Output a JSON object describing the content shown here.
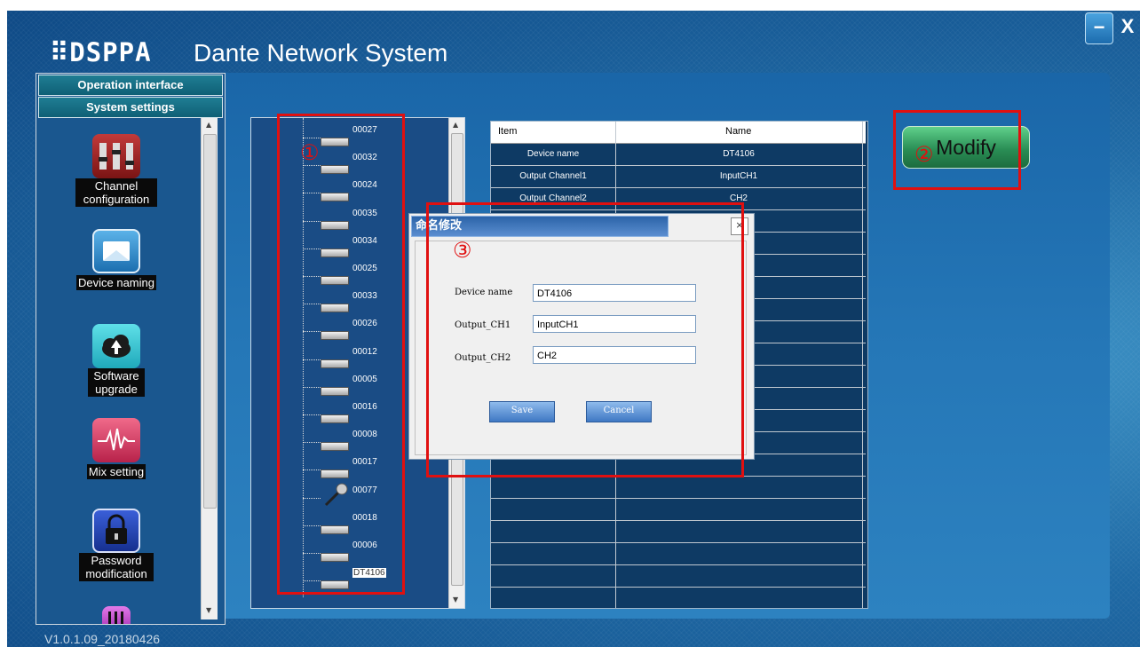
{
  "window": {
    "brand": "⠿DSPPA",
    "title": "Dante Network System",
    "minimize_glyph": "−",
    "close_glyph": "X",
    "version": "V1.0.1.09_20180426"
  },
  "sidebar": {
    "tabs": [
      "Operation interface",
      "System settings"
    ],
    "items": [
      {
        "label": "Channel configuration",
        "icon": "channel-config-icon"
      },
      {
        "label": "Device naming",
        "icon": "device-naming-icon"
      },
      {
        "label": "Software upgrade",
        "icon": "cloud-upload-icon"
      },
      {
        "label": "Mix setting",
        "icon": "mix-waveform-icon"
      },
      {
        "label": "Password modification",
        "icon": "lock-icon"
      }
    ]
  },
  "device_list": {
    "devices": [
      "00027",
      "00032",
      "00024",
      "00035",
      "00034",
      "00025",
      "00033",
      "00026",
      "00012",
      "00005",
      "00016",
      "00008",
      "00017",
      "00077",
      "00018",
      "00006",
      "DT4106"
    ],
    "selected": "DT4106"
  },
  "table": {
    "headers": [
      "Item",
      "Name"
    ],
    "rows": [
      {
        "item": "Device name",
        "name": "DT4106"
      },
      {
        "item": "Output Channel1",
        "name": "InputCH1"
      },
      {
        "item": "Output Channel2",
        "name": "CH2"
      }
    ]
  },
  "modify_button": "Modify",
  "dialog": {
    "title": "命名修改",
    "close_glyph": "×",
    "fields": [
      {
        "label": "Device name",
        "value": "DT4106"
      },
      {
        "label": "Output_CH1",
        "value": "InputCH1"
      },
      {
        "label": "Output_CH2",
        "value": "CH2"
      }
    ],
    "save_label": "Save",
    "cancel_label": "Cancel"
  },
  "annotations": [
    "①",
    "②",
    "③"
  ],
  "colors": {
    "annotation": "#e01010",
    "modify_button": "#3fae6c",
    "background": "#1f6aa5"
  }
}
